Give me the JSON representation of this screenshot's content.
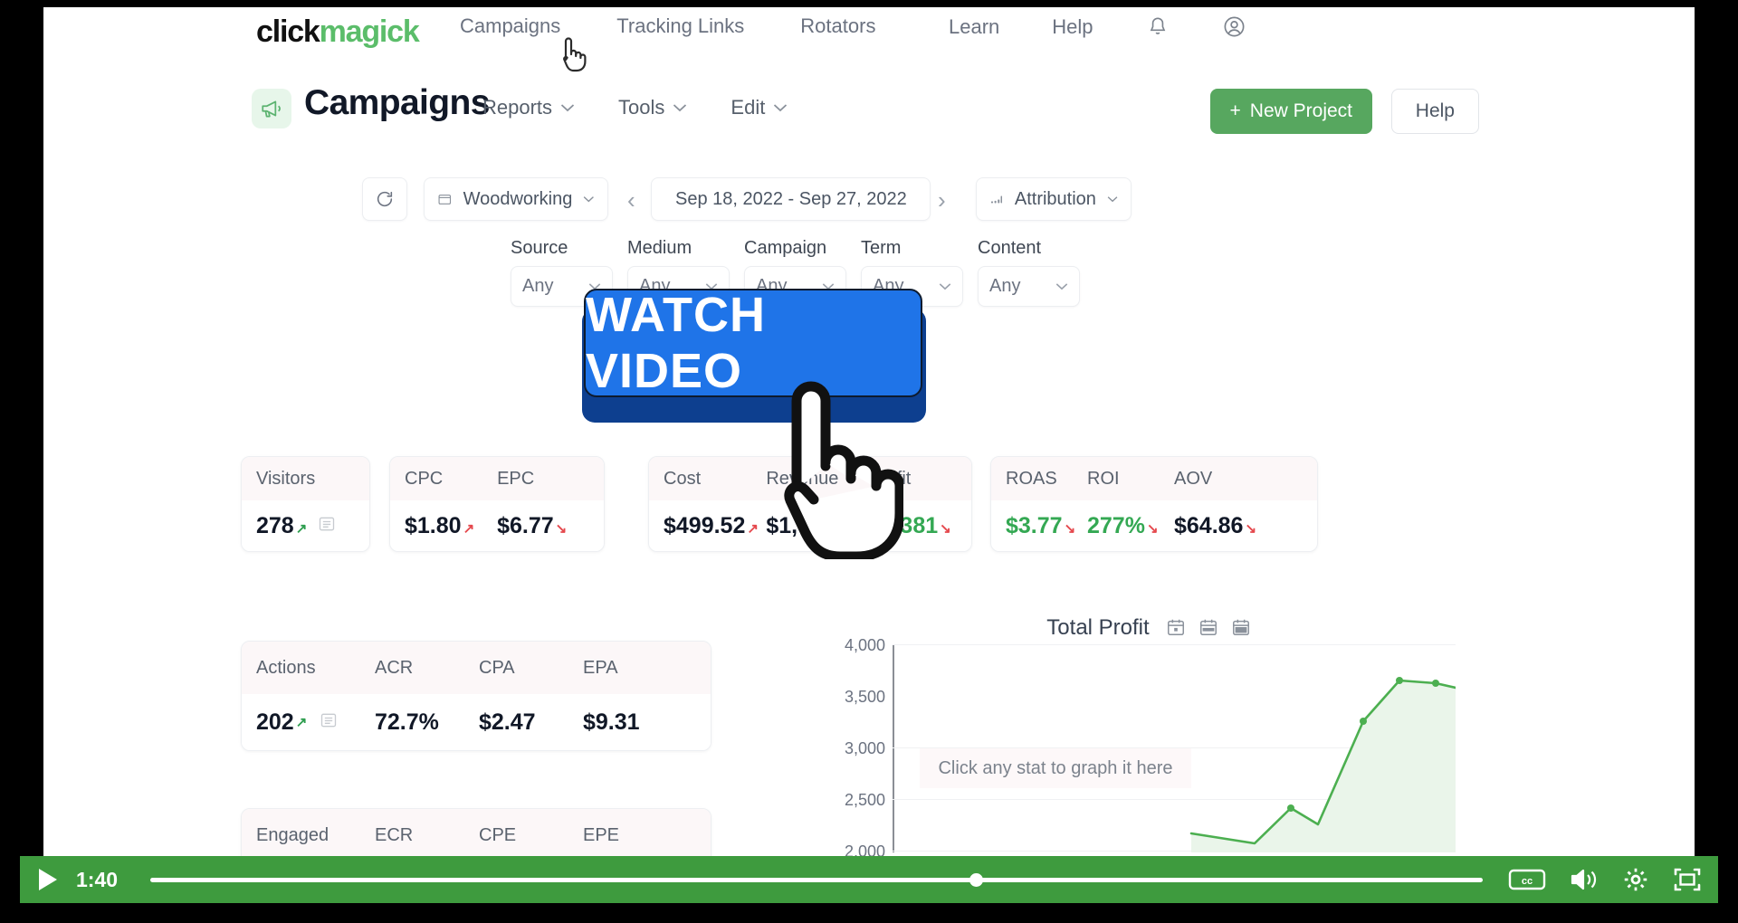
{
  "brand": {
    "part1": "click",
    "part2": "magick"
  },
  "topnav": {
    "links": [
      {
        "label": "Campaigns",
        "name": "nav-campaigns"
      },
      {
        "label": "Tracking Links",
        "name": "nav-tracking-links"
      },
      {
        "label": "Rotators",
        "name": "nav-rotators"
      }
    ],
    "right": [
      {
        "label": "Learn",
        "name": "nav-learn"
      },
      {
        "label": "Help",
        "name": "nav-help"
      }
    ],
    "icons": [
      "bell-icon",
      "user-account-icon"
    ]
  },
  "header": {
    "icon": "megaphone-icon",
    "title": "Campaigns",
    "menus": [
      {
        "label": "Reports"
      },
      {
        "label": "Tools"
      },
      {
        "label": "Edit"
      }
    ],
    "new_project_label": "New Project",
    "new_project_plus": "+",
    "help_label": "Help",
    "accent_green": "#57a75f"
  },
  "toolbar": {
    "refresh_icon": "refresh-icon",
    "project_icon": "folder-icon",
    "project_label": "Woodworking",
    "prev_label": "‹",
    "next_label": "›",
    "date_icon": "calendar-icon",
    "date_label": "Sep 18, 2022 - Sep 27, 2022",
    "attribution_icon": "bar-chart-icon",
    "attribution_label": "Attribution",
    "chevron": "⌄"
  },
  "dimension_filters": [
    {
      "label": "Source",
      "value": "Any"
    },
    {
      "label": "Medium",
      "value": "Any"
    },
    {
      "label": "Campaign",
      "value": "Any"
    },
    {
      "label": "Term",
      "value": "Any"
    },
    {
      "label": "Content",
      "value": "Any"
    }
  ],
  "stat_cards": {
    "visitors": {
      "headers": [
        "Visitors"
      ],
      "values": [
        {
          "text": "278",
          "color": "black",
          "trend": "up-green",
          "has_list_icon": true
        }
      ]
    },
    "cpc_epc": {
      "headers": [
        "CPC",
        "EPC"
      ],
      "values": [
        {
          "text": "$1.80",
          "color": "black",
          "trend": "up-red"
        },
        {
          "text": "$6.77",
          "color": "black",
          "trend": "down-red"
        }
      ]
    },
    "cost_revenue_profit": {
      "headers": [
        "Cost",
        "Revenue",
        "Profit"
      ],
      "values": [
        {
          "text": "$499.52",
          "color": "black",
          "trend": "up-red"
        },
        {
          "text": "$1,",
          "color": "black",
          "trend": "none"
        },
        {
          "text": "$1,381",
          "color": "green",
          "trend": "down-red"
        }
      ]
    },
    "roas_roi_aov": {
      "headers": [
        "ROAS",
        "ROI",
        "AOV"
      ],
      "values": [
        {
          "text": "$3.77",
          "color": "green",
          "trend": "down-red"
        },
        {
          "text": "277%",
          "color": "green",
          "trend": "down-red"
        },
        {
          "text": "$64.86",
          "color": "black",
          "trend": "down-red"
        }
      ]
    },
    "actions": {
      "headers": [
        "Actions",
        "ACR",
        "CPA",
        "EPA"
      ],
      "values": [
        {
          "text": "202",
          "color": "black",
          "trend": "up-green",
          "has_list_icon": true
        },
        {
          "text": "72.7%",
          "color": "black",
          "trend": "none"
        },
        {
          "text": "$2.47",
          "color": "black",
          "trend": "none"
        },
        {
          "text": "$9.31",
          "color": "black",
          "trend": "none"
        }
      ]
    },
    "engaged": {
      "headers": [
        "Engaged",
        "ECR",
        "CPE",
        "EPE"
      ]
    }
  },
  "chart_data": {
    "type": "area",
    "title": "Total Profit",
    "xlabel": "",
    "ylabel": "",
    "ylim": [
      2000,
      4000
    ],
    "yticks": [
      "4,000",
      "3,500",
      "3,000",
      "2,500",
      "2,000"
    ],
    "grid": true,
    "legend": "none",
    "hint": "Click any stat to graph it here",
    "series": [
      {
        "name": "Total Profit",
        "color": "#4caf50",
        "values": [
          2180,
          2080,
          2420,
          2260,
          3250,
          3700,
          3680,
          3620
        ]
      }
    ],
    "icons": [
      "calendar-day-icon",
      "calendar-week-icon",
      "calendar-month-icon"
    ]
  },
  "cta": {
    "label": "WATCH VIDEO",
    "bg": "#1f74e8",
    "shadow": "#0d3f8f"
  },
  "video": {
    "play_label": "play-icon",
    "time": "1:40",
    "progress_pct": 62,
    "bar_color": "#3e9b3e",
    "controls": [
      "cc-icon",
      "volume-icon",
      "settings-gear-icon",
      "fullscreen-icon"
    ]
  }
}
